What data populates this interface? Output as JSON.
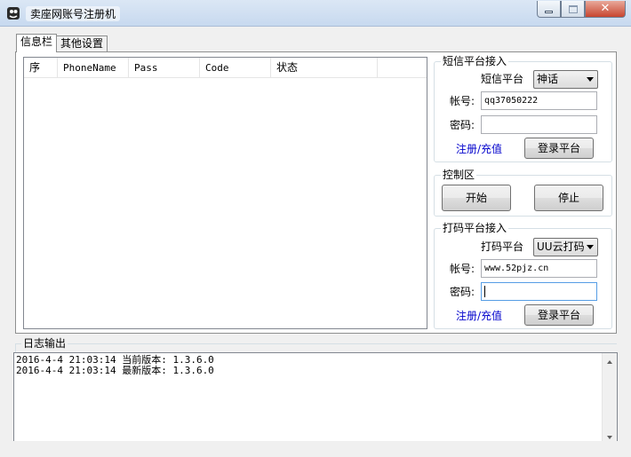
{
  "window": {
    "title": "卖座网账号注册机"
  },
  "tabs": [
    {
      "label": "信息栏"
    },
    {
      "label": "其他设置"
    }
  ],
  "list": {
    "columns": [
      "序",
      "PhoneName",
      "Pass",
      "Code",
      "状态"
    ]
  },
  "sms": {
    "group_title": "短信平台接入",
    "platform_label": "短信平台",
    "platform_value": "神话",
    "account_label": "帐号:",
    "account_value": "qq37050222",
    "password_label": "密码:",
    "password_value": "",
    "register_link": "注册/充值",
    "login_button": "登录平台"
  },
  "control": {
    "group_title": "控制区",
    "start_button": "开始",
    "stop_button": "停止"
  },
  "captcha": {
    "group_title": "打码平台接入",
    "platform_label": "打码平台",
    "platform_value": "UU云打码",
    "account_label": "帐号:",
    "account_value": "www.52pjz.cn",
    "password_label": "密码:",
    "password_value": "",
    "register_link": "注册/充值",
    "login_button": "登录平台"
  },
  "log": {
    "title": "日志输出",
    "lines": [
      "2016-4-4 21:03:14 当前版本: 1.3.6.0",
      "2016-4-4 21:03:14 最新版本: 1.3.6.0"
    ]
  }
}
